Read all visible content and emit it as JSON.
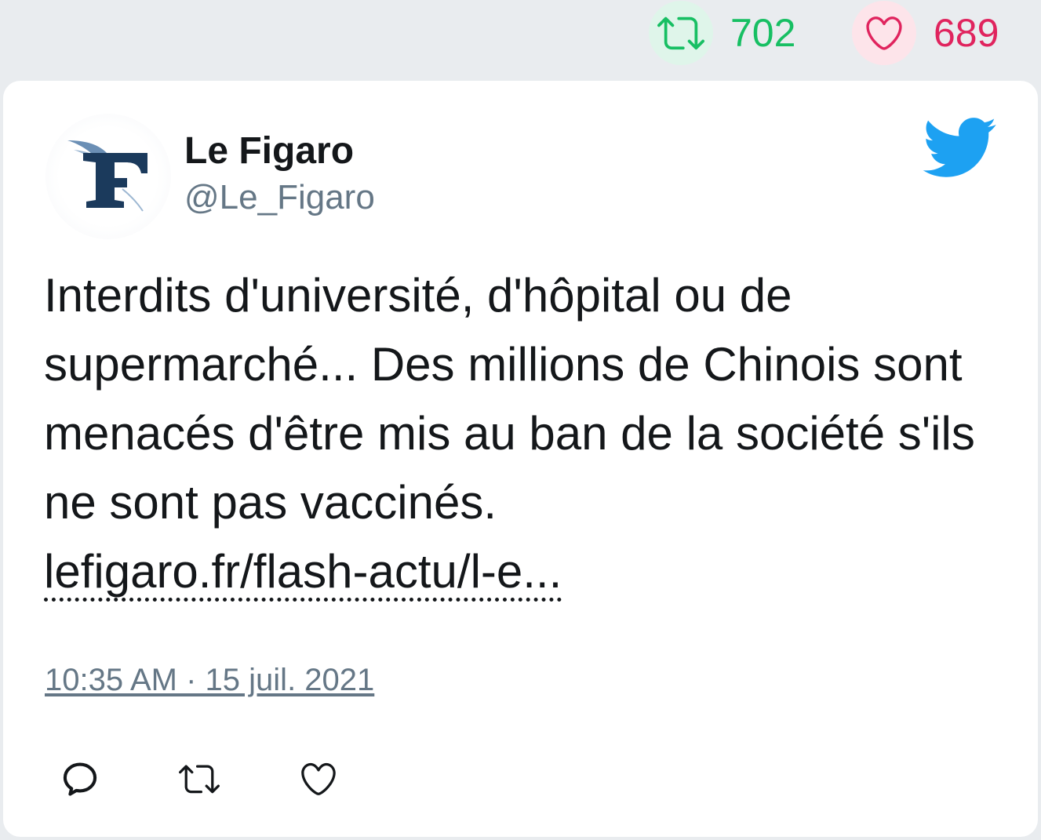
{
  "stats": {
    "retweets": "702",
    "likes": "689"
  },
  "tweet": {
    "author_name": "Le Figaro",
    "author_handle": "@Le_Figaro",
    "text": "Interdits d'université, d'hôpital ou de supermarché... Des millions de Chinois sont menacés d'être mis au ban de la société s'ils ne sont pas vaccinés.",
    "link": "lefigaro.fr/flash-actu/l-e...",
    "timestamp": "10:35 AM · 15 juil. 2021"
  },
  "icons": {
    "retweet": "retweet-icon",
    "like": "heart-icon",
    "reply": "reply-icon",
    "brand": "twitter-bird-icon",
    "avatar": "le-figaro-logo"
  },
  "colors": {
    "retweet": "#17bf63",
    "like": "#e0245e",
    "twitter_blue": "#1da1f2",
    "figaro_navy": "#1b3a5c",
    "secondary_text": "#657786"
  }
}
